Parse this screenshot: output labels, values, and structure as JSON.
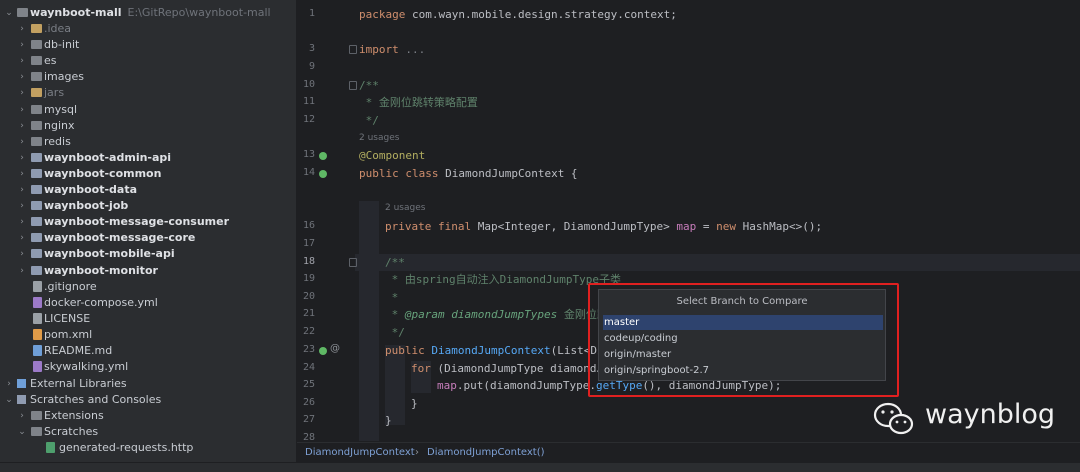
{
  "project": {
    "root": {
      "name": "waynboot-mall",
      "path": "E:\\GitRepo\\waynboot-mall"
    },
    "items": [
      {
        "label": ".idea",
        "kind": "folder",
        "style": "dim"
      },
      {
        "label": "db-init",
        "kind": "folder"
      },
      {
        "label": "es",
        "kind": "folder"
      },
      {
        "label": "images",
        "kind": "folder"
      },
      {
        "label": "jars",
        "kind": "folder",
        "style": "dim"
      },
      {
        "label": "mysql",
        "kind": "folder"
      },
      {
        "label": "nginx",
        "kind": "folder"
      },
      {
        "label": "redis",
        "kind": "folder"
      },
      {
        "label": "waynboot-admin-api",
        "kind": "module"
      },
      {
        "label": "waynboot-common",
        "kind": "module"
      },
      {
        "label": "waynboot-data",
        "kind": "module"
      },
      {
        "label": "waynboot-job",
        "kind": "module"
      },
      {
        "label": "waynboot-message-consumer",
        "kind": "module"
      },
      {
        "label": "waynboot-message-core",
        "kind": "module"
      },
      {
        "label": "waynboot-mobile-api",
        "kind": "module"
      },
      {
        "label": "waynboot-monitor",
        "kind": "module"
      },
      {
        "label": ".gitignore",
        "kind": "file"
      },
      {
        "label": "docker-compose.yml",
        "kind": "yml"
      },
      {
        "label": "LICENSE",
        "kind": "file"
      },
      {
        "label": "pom.xml",
        "kind": "xml"
      },
      {
        "label": "README.md",
        "kind": "md"
      },
      {
        "label": "skywalking.yml",
        "kind": "yml"
      }
    ],
    "external_libraries": "External Libraries",
    "scratches": "Scratches and Consoles",
    "extensions": "Extensions",
    "scratches_folder": "Scratches",
    "scratch_file": "generated-requests.http"
  },
  "editor": {
    "line_numbers": [
      "1",
      "3",
      "9",
      "10",
      "11",
      "12",
      "13",
      "14",
      "16",
      "17",
      "18",
      "19",
      "20",
      "21",
      "22",
      "23",
      "24",
      "25",
      "26",
      "27",
      "28"
    ],
    "usages_2a": "2 usages",
    "usages_2b": "2 usages",
    "code": {
      "l1_kw": "package",
      "l1_rest": " com.wayn.mobile.design.strategy.context;",
      "l3_kw": "import",
      "l3_rest": " ...",
      "l10": "/**",
      "l11": " * 金刚位跳转策略配置",
      "l12": " */",
      "l13": "@Component",
      "l14_kw": "public class",
      "l14_rest": " DiamondJumpContext {",
      "l16_kw": "private final",
      "l16_a": " Map<Integer, DiamondJumpType> ",
      "l16_f": "map",
      "l16_b": " = ",
      "l16_kw2": "new",
      "l16_c": " HashMap<>();",
      "l18": "/**",
      "l19": " * 由spring自动注入DiamondJumpType子类",
      "l20": " *",
      "l21_a": " * ",
      "l21_tag": "@param",
      "l21_p": " diamondJumpTypes",
      "l21_rest": " 金刚位跳",
      "l22": " */",
      "l23_kw": "public",
      "l23_fn": " DiamondJumpContext",
      "l23_rest": "(List<Dia",
      "l24_kw": "for",
      "l24_rest": " (DiamondJumpType diamondJu",
      "l25_f": "map",
      "l25_a": ".put(diamondJumpType.",
      "l25_fn": "getType",
      "l25_b": "(), diamondJumpType);",
      "l26": "}",
      "l27": "}"
    }
  },
  "breadcrumb": [
    "DiamondJumpContext",
    "DiamondJumpContext()"
  ],
  "popup": {
    "title": "Select Branch to Compare",
    "branches": [
      "master",
      "codeup/coding",
      "origin/master",
      "origin/springboot-2.7"
    ],
    "selected_index": 0
  },
  "watermark": "waynblog",
  "colors": {
    "selection": "#2e436e",
    "highlight_box": "#e02020",
    "keyword": "#cf8e6d",
    "annotation": "#b3ae60"
  }
}
